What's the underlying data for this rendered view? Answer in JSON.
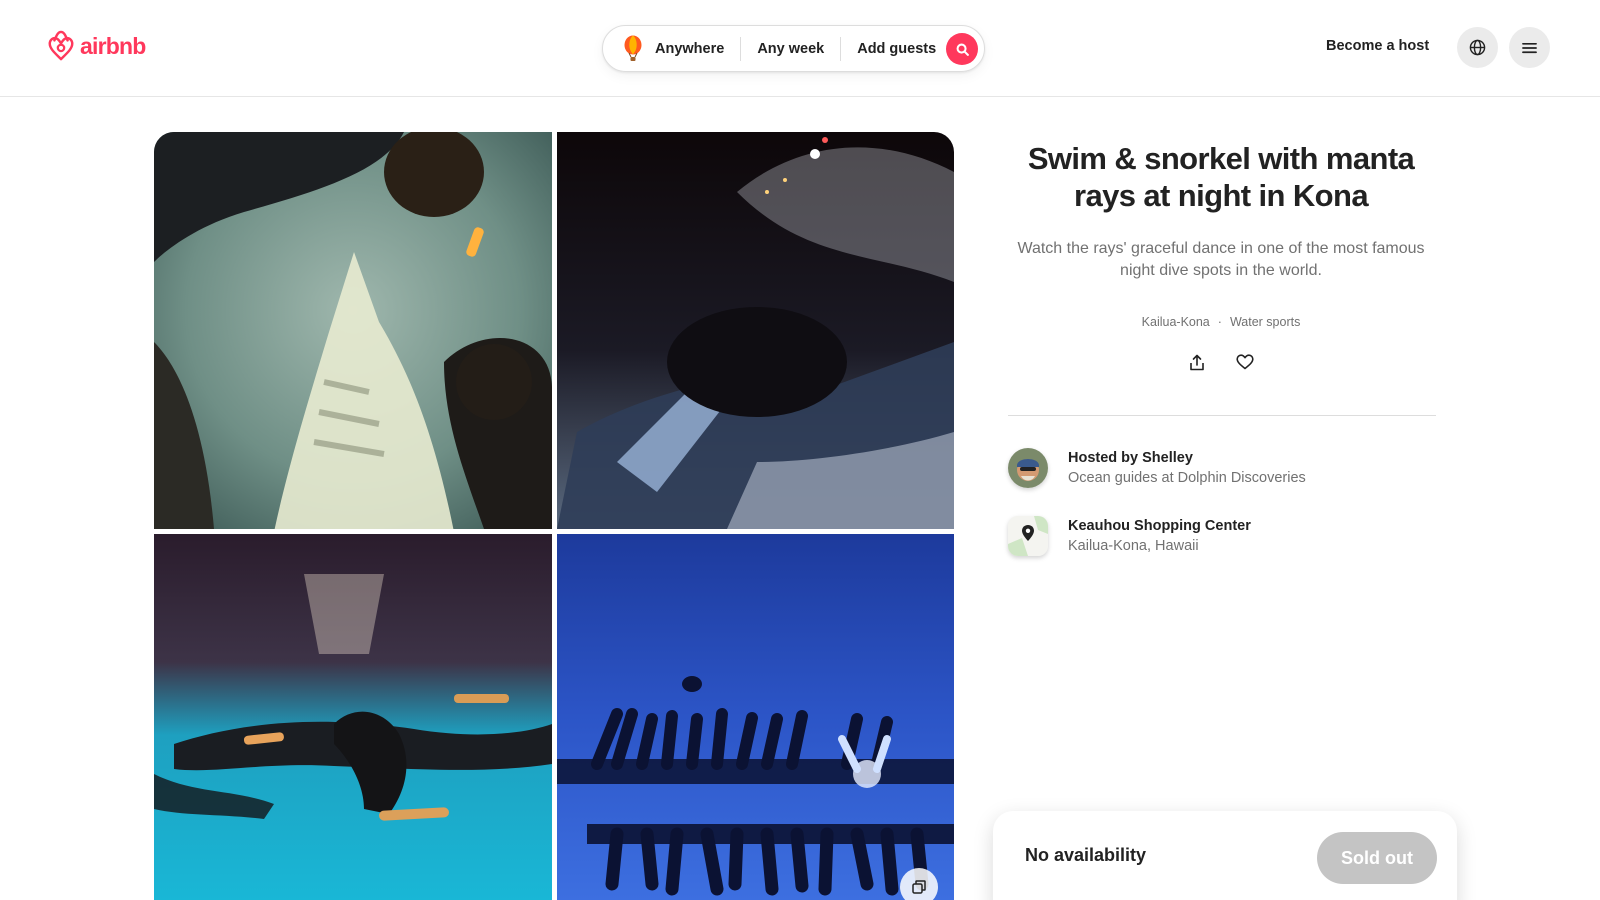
{
  "header": {
    "logo_text": "airbnb",
    "search": {
      "location": "Anywhere",
      "dates": "Any week",
      "guests": "Add guests"
    },
    "become_host": "Become a host",
    "icons": [
      "balloon-icon",
      "search-icon",
      "globe-icon",
      "menu-icon"
    ]
  },
  "gallery": {
    "photos": [
      "manta-ray-snorkelers",
      "night-boat-water",
      "night-snorkelers-surface",
      "divers-silhouettes-blue"
    ],
    "show_all_icon": "gallery-icon"
  },
  "experience": {
    "title": "Swim & snorkel with manta rays at night in Kona",
    "subtitle": "Watch the rays' graceful dance in one of the most famous night dive spots in the world.",
    "tags": [
      "Kailua-Kona",
      "Water sports"
    ],
    "tag_separator": "·"
  },
  "host": {
    "title": "Hosted by Shelley",
    "subtitle": "Ocean guides at Dolphin Discoveries"
  },
  "location": {
    "title": "Keauhou Shopping Center",
    "subtitle": "Kailua-Kona, Hawaii"
  },
  "booking": {
    "status": "No availability",
    "button": "Sold out"
  },
  "colors": {
    "brand": "#FF385C",
    "text": "#222222",
    "muted": "#717171",
    "disabled": "#c4c4c4"
  }
}
